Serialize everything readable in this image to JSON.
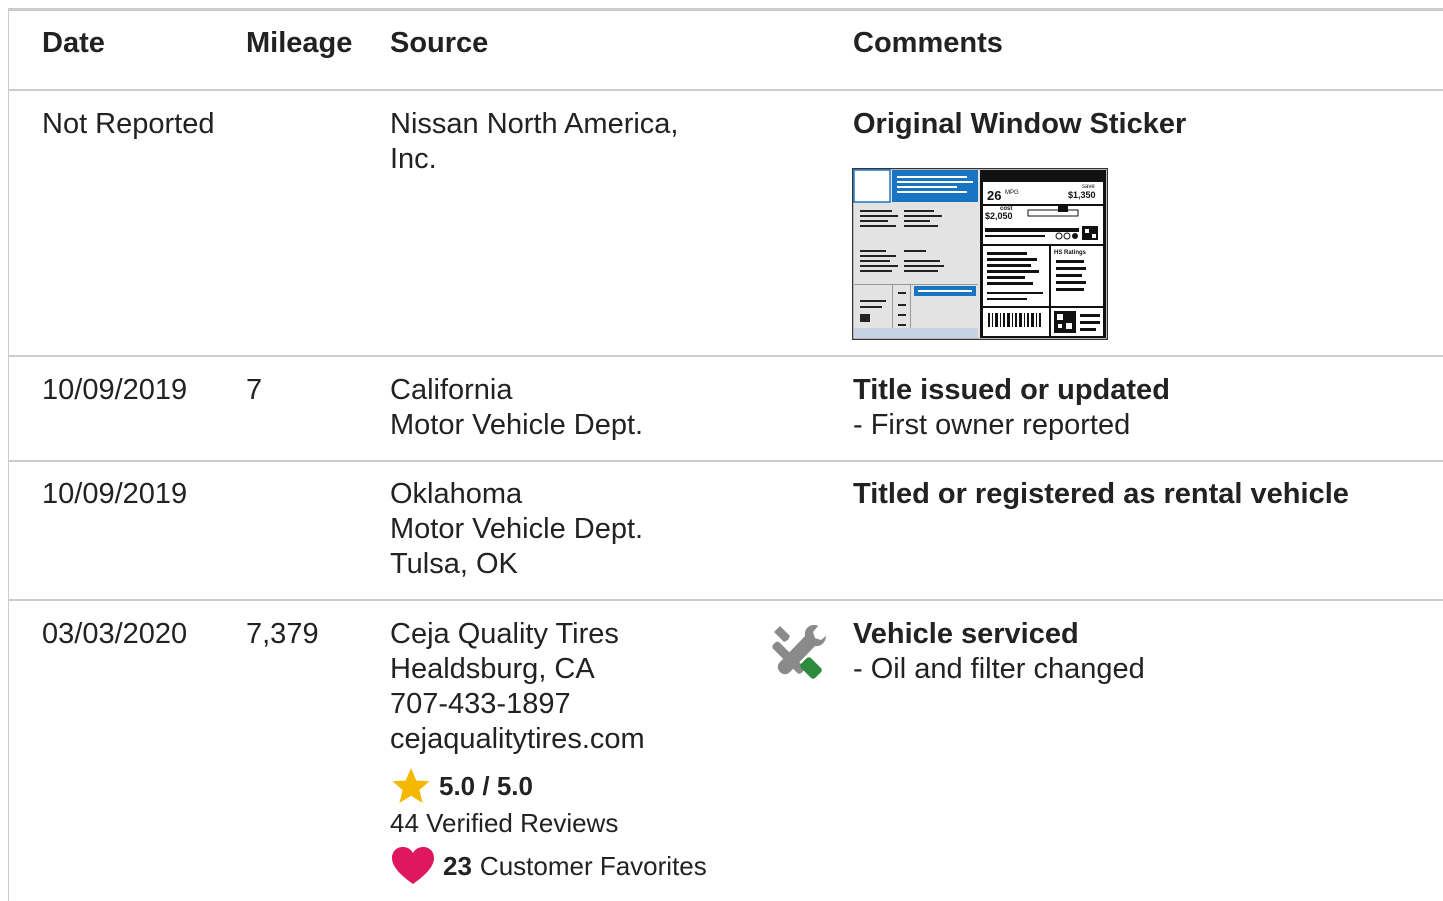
{
  "headers": {
    "date": "Date",
    "mileage": "Mileage",
    "source": "Source",
    "comments": "Comments"
  },
  "rows": [
    {
      "date": "Not Reported",
      "mileage": "",
      "source": [
        "Nissan North America,",
        "Inc."
      ],
      "comment_title": "Original Window Sticker",
      "comment_detail": "",
      "sticker": {
        "mpg": "26",
        "mpg_unit": "MPG",
        "save_label": "save",
        "save_value": "$1,350",
        "cost_label": "cost",
        "cost_value": "$2,050",
        "ratings_label": "HS Ratings"
      }
    },
    {
      "date": "10/09/2019",
      "mileage": "7",
      "source": [
        "California",
        "Motor Vehicle Dept."
      ],
      "comment_title": "Title issued or updated",
      "comment_detail": "- First owner reported"
    },
    {
      "date": "10/09/2019",
      "mileage": "",
      "source": [
        "Oklahoma",
        "Motor Vehicle Dept.",
        "Tulsa, OK"
      ],
      "comment_title": "Titled or registered as rental vehicle",
      "comment_detail": ""
    },
    {
      "date": "03/03/2020",
      "mileage": "7,379",
      "source": [
        "Ceja Quality Tires",
        "Healdsburg, CA",
        "707-433-1897",
        "cejaqualitytires.com"
      ],
      "rating": "5.0 / 5.0",
      "reviews": "44 Verified Reviews",
      "favorites_count": "23",
      "favorites_label": "Customer Favorites",
      "service_icon": "wrench-screwdriver-icon",
      "comment_title": "Vehicle serviced",
      "comment_detail": "- Oil and filter changed"
    }
  ],
  "colors": {
    "border": "#cccccc",
    "star": "#f5b800",
    "heart": "#e0175e",
    "wrench_handle": "#2e8b3e",
    "sticker_blue": "#1a74c4"
  }
}
